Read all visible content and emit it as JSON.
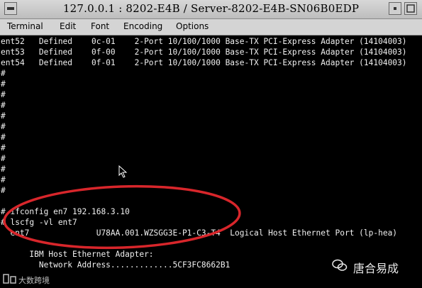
{
  "window": {
    "title": "127.0.0.1 : 8202-E4B / Server-8202-E4B-SN06B0EDP"
  },
  "menu": [
    "Terminal",
    "Edit",
    "Font",
    "Encoding",
    "Options"
  ],
  "terminal": {
    "lines": [
      "ent52   Defined    0c-01    2-Port 10/100/1000 Base-TX PCI-Express Adapter (14104003)",
      "ent53   Defined    0f-00    2-Port 10/100/1000 Base-TX PCI-Express Adapter (14104003)",
      "ent54   Defined    0f-01    2-Port 10/100/1000 Base-TX PCI-Express Adapter (14104003)",
      "#",
      "#",
      "#",
      "#",
      "#",
      "#",
      "#",
      "#",
      "#",
      "#",
      "#",
      "#",
      "# ifconfig en7 192.168.3.10",
      "# lscfg -vl ent7",
      "  ent7              U78AA.001.WZSGG3E-P1-C3-T4  Logical Host Ethernet Port (lp-hea)",
      "",
      "      IBM Host Ethernet Adapter:",
      "        Network Address.............5CF3FC8662B1"
    ]
  },
  "watermark": {
    "brand": "唐合易成",
    "sub": "大数跨境"
  },
  "colors": {
    "annotation_ring": "#d8262b"
  }
}
